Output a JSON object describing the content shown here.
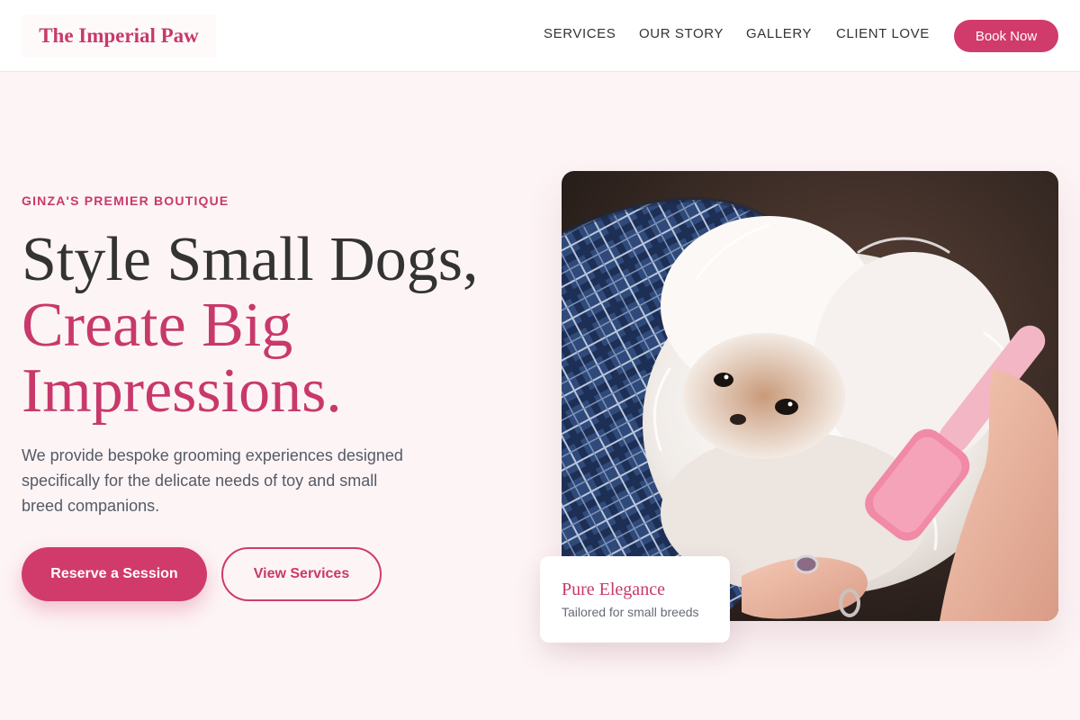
{
  "header": {
    "logo": "The Imperial Paw",
    "nav": [
      "SERVICES",
      "OUR STORY",
      "GALLERY",
      "CLIENT LOVE"
    ],
    "cta": "Book Now"
  },
  "hero": {
    "eyebrow": "GINZA'S PREMIER BOUTIQUE",
    "headline": {
      "line1": "Style Small Dogs,",
      "line2": "Create Big",
      "line3": "Impressions."
    },
    "description": "We provide bespoke grooming experiences designed specifically for the delicate needs of toy and small breed companions.",
    "primary_button": "Reserve a Session",
    "secondary_button": "View Services",
    "image_alt": "Small fluffy white dog being brushed",
    "card": {
      "title": "Pure Elegance",
      "subtitle": "Tailored for small breeds"
    }
  },
  "colors": {
    "accent": "#d03b6c",
    "background": "#fdf4f5",
    "text": "#333333"
  }
}
